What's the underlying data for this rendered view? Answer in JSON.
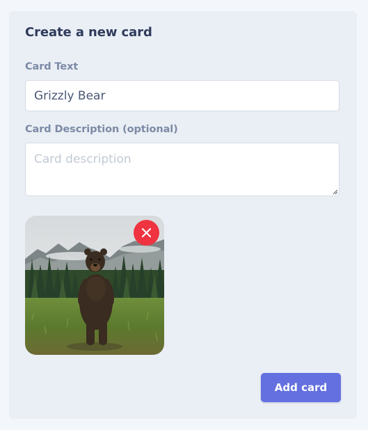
{
  "form": {
    "title": "Create a new card",
    "card_text_label": "Card Text",
    "card_text_value": "Grizzly Bear",
    "description_label": "Card Description (optional)",
    "description_placeholder": "Card description",
    "description_value": "",
    "image": {
      "subject": "grizzly bear standing in a meadow before pine forest and misty mountains",
      "remove_icon": "close-icon"
    },
    "submit_label": "Add card"
  },
  "colors": {
    "page_background": "#f3f6fa",
    "panel_background": "#eaeff5",
    "title": "#2f3b5c",
    "label": "#7c8aa6",
    "accent_button": "#6470e0",
    "remove_button": "#ef3340"
  }
}
